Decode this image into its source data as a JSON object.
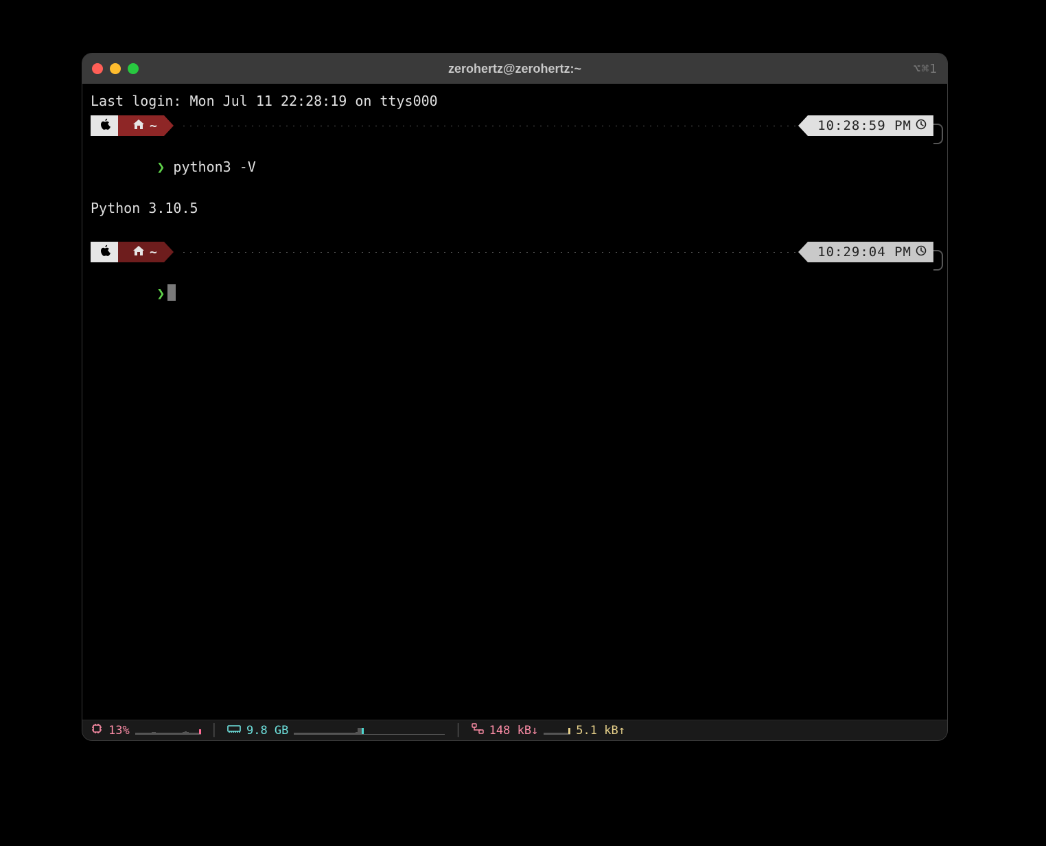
{
  "window": {
    "title": "zerohertz@zerohertz:~",
    "tab_indicator": "⌥⌘1"
  },
  "terminal": {
    "last_login": "Last login: Mon Jul 11 22:28:19 on ttys000",
    "prompts": [
      {
        "path_tilde": "~",
        "timestamp": "10:28:59 PM",
        "caret": "❯",
        "command": "python3 -V",
        "output": "Python 3.10.5"
      },
      {
        "path_tilde": "~",
        "timestamp": "10:29:04 PM",
        "caret": "❯",
        "command": "",
        "output": ""
      }
    ]
  },
  "statusbar": {
    "cpu_percent": "13%",
    "memory": "9.8 GB",
    "net_down": "148 kB↓",
    "net_up": "5.1 kB↑"
  },
  "icons": {
    "apple": "apple-icon",
    "home": "home-icon",
    "clock": "clock-icon",
    "chip": "chip-icon",
    "ram": "memory-icon",
    "net": "network-icon"
  }
}
